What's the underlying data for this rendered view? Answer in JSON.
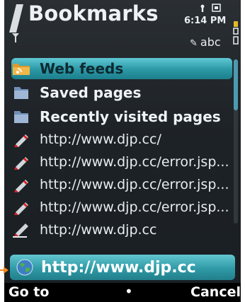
{
  "header": {
    "title": "Bookmarks",
    "time": "6:14 PM",
    "input_mode": "abc",
    "input_mode_icon": "pen-icon"
  },
  "list": {
    "items": [
      {
        "label": "Web feeds",
        "type": "folder",
        "icon": "feed-folder-icon",
        "selected": true
      },
      {
        "label": "Saved pages",
        "type": "folder",
        "icon": "folder-icon",
        "selected": false
      },
      {
        "label": "Recently visited pages",
        "type": "folder",
        "icon": "folder-icon",
        "selected": false
      },
      {
        "label": "http://www.djp.cc/",
        "type": "link",
        "icon": "bookmark-pen-icon",
        "selected": false
      },
      {
        "label": "http://www.djp.cc/error.jsp...",
        "type": "link",
        "icon": "bookmark-pen-icon",
        "selected": false
      },
      {
        "label": "http://www.djp.cc/error.jsp...",
        "type": "link",
        "icon": "bookmark-pen-icon",
        "selected": false
      },
      {
        "label": "http://www.djp.cc/error.jsp...",
        "type": "link",
        "icon": "bookmark-pen-icon",
        "selected": false
      },
      {
        "label": "http://www.djp.cc",
        "type": "link",
        "icon": "bookmark-pen-icon",
        "selected": false
      }
    ]
  },
  "address_bar": {
    "value": "http://www.djp.cc",
    "icon": "globe-icon"
  },
  "softkeys": {
    "left": "Go to",
    "middle": "•",
    "right": "Cancel"
  },
  "colors": {
    "highlight": "#2b98a6",
    "background": "#1d2226",
    "text": "#eef3f5"
  }
}
